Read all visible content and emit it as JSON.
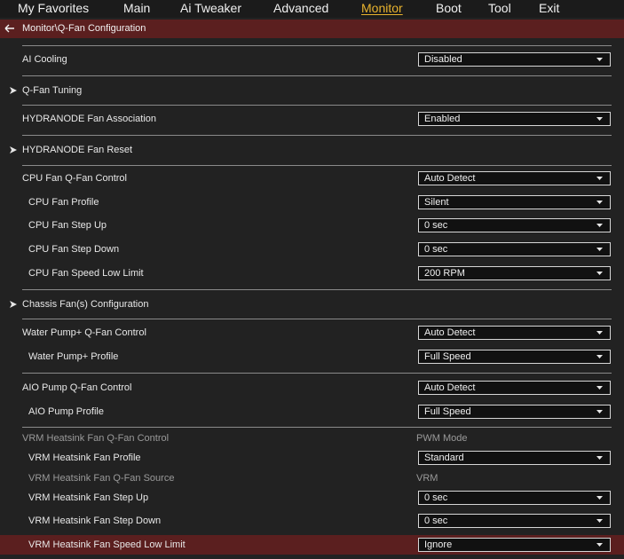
{
  "menu": {
    "tabs": [
      "My Favorites",
      "Main",
      "Ai Tweaker",
      "Advanced",
      "Monitor",
      "Boot",
      "Tool",
      "Exit"
    ],
    "active": "Monitor"
  },
  "breadcrumb": "Monitor\\Q-Fan Configuration",
  "items": [
    {
      "label": "AI Cooling",
      "value": "Disabled"
    },
    {
      "label": "Q-Fan Tuning"
    },
    {
      "label": "HYDRANODE Fan Association",
      "value": "Enabled"
    },
    {
      "label": "HYDRANODE Fan Reset"
    },
    {
      "label": "CPU Fan Q-Fan Control",
      "value": "Auto Detect"
    },
    {
      "label": "CPU Fan Profile",
      "value": "Silent"
    },
    {
      "label": "CPU Fan Step Up",
      "value": "0 sec"
    },
    {
      "label": "CPU Fan Step Down",
      "value": "0 sec"
    },
    {
      "label": "CPU Fan Speed Low Limit",
      "value": "200 RPM"
    },
    {
      "label": "Chassis Fan(s) Configuration"
    },
    {
      "label": "Water Pump+ Q-Fan Control",
      "value": "Auto Detect"
    },
    {
      "label": "Water Pump+ Profile",
      "value": "Full Speed"
    },
    {
      "label": "AIO Pump Q-Fan Control",
      "value": "Auto Detect"
    },
    {
      "label": "AIO Pump Profile",
      "value": "Full Speed"
    },
    {
      "label": "VRM Heatsink Fan Q-Fan Control",
      "value": "PWM Mode"
    },
    {
      "label": "VRM Heatsink Fan Profile",
      "value": "Standard"
    },
    {
      "label": "VRM Heatsink Fan Q-Fan Source",
      "value": "VRM"
    },
    {
      "label": "VRM Heatsink Fan Step Up",
      "value": "0 sec"
    },
    {
      "label": "VRM Heatsink Fan Step Down",
      "value": "0 sec"
    },
    {
      "label": "VRM Heatsink Fan Speed Low Limit",
      "value": "Ignore"
    }
  ],
  "colors": {
    "accent_tab": "#e8b32e",
    "highlight": "#5b1f1f",
    "background": "#222222"
  }
}
